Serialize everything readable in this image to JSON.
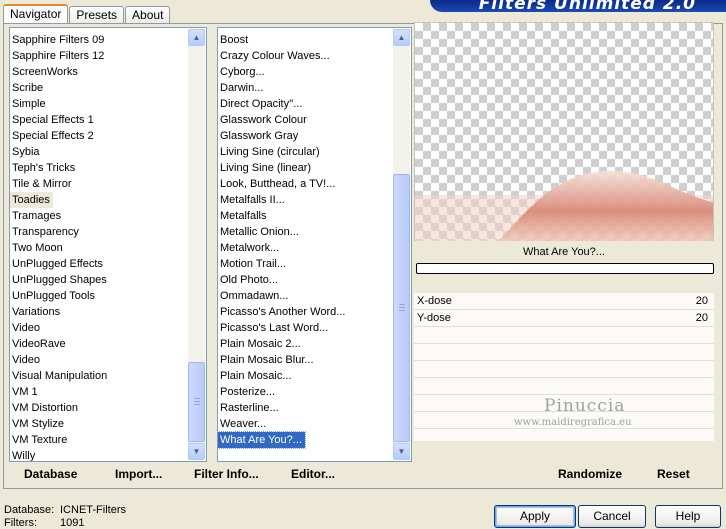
{
  "tabs": [
    "Navigator",
    "Presets",
    "About"
  ],
  "banner_title": "Filters Unlimited 2.0",
  "categories": [
    "Sapphire Filters 09",
    "Sapphire Filters 12",
    "ScreenWorks",
    "Scribe",
    "Simple",
    "Special Effects 1",
    "Special Effects 2",
    "Sybia",
    "Teph's Tricks",
    "Tile & Mirror",
    "Toadies",
    "Tramages",
    "Transparency",
    "Two Moon",
    "UnPlugged Effects",
    "UnPlugged Shapes",
    "UnPlugged Tools",
    "Variations",
    "Video",
    "VideoRave",
    "Video",
    "Visual Manipulation",
    "VM 1",
    "VM Distortion",
    "VM Stylize",
    "VM Texture",
    "Willy"
  ],
  "selected_category": "Toadies",
  "filters": [
    "Boost",
    "Crazy Colour Waves...",
    "Cyborg...",
    "Darwin...",
    "Direct Opacity''...",
    "Glasswork Colour",
    "Glasswork Gray",
    "Living Sine (circular)",
    "Living Sine (linear)",
    "Look, Butthead, a TV!...",
    "Metalfalls II...",
    "Metalfalls",
    "Metallic Onion...",
    "Metalwork...",
    "Motion Trail...",
    "Old Photo...",
    "Ommadawn...",
    "Picasso's Another Word...",
    "Picasso's Last Word...",
    "Plain Mosaic 2...",
    "Plain Mosaic Blur...",
    "Plain Mosaic...",
    "Posterize...",
    "Rasterline...",
    "Weaver...",
    "What Are You?..."
  ],
  "selected_filter": "What Are You?...",
  "preview": {
    "filter_name": "What Are You?...",
    "progress": 0
  },
  "params": [
    {
      "name": "X-dose",
      "value": "20"
    },
    {
      "name": "Y-dose",
      "value": "20"
    }
  ],
  "watermark": {
    "name": "Pinuccia",
    "site": "www.maidiregrafica.eu"
  },
  "bottom_buttons": {
    "database": "Database",
    "import": "Import...",
    "filter_info": "Filter Info...",
    "editor": "Editor...",
    "randomize": "Randomize",
    "reset": "Reset"
  },
  "status": {
    "database_label": "Database:",
    "database_value": "ICNET-Filters",
    "filters_label": "Filters:",
    "filters_value": "1091"
  },
  "dialog_buttons": {
    "apply": "Apply",
    "cancel": "Cancel",
    "help": "Help"
  },
  "colors": {
    "selection": "#316ac5",
    "banner": "#1c49b5",
    "preview_tint": "#d98a78"
  },
  "icons": {
    "scroll_up": "▲",
    "scroll_down": "▼"
  }
}
